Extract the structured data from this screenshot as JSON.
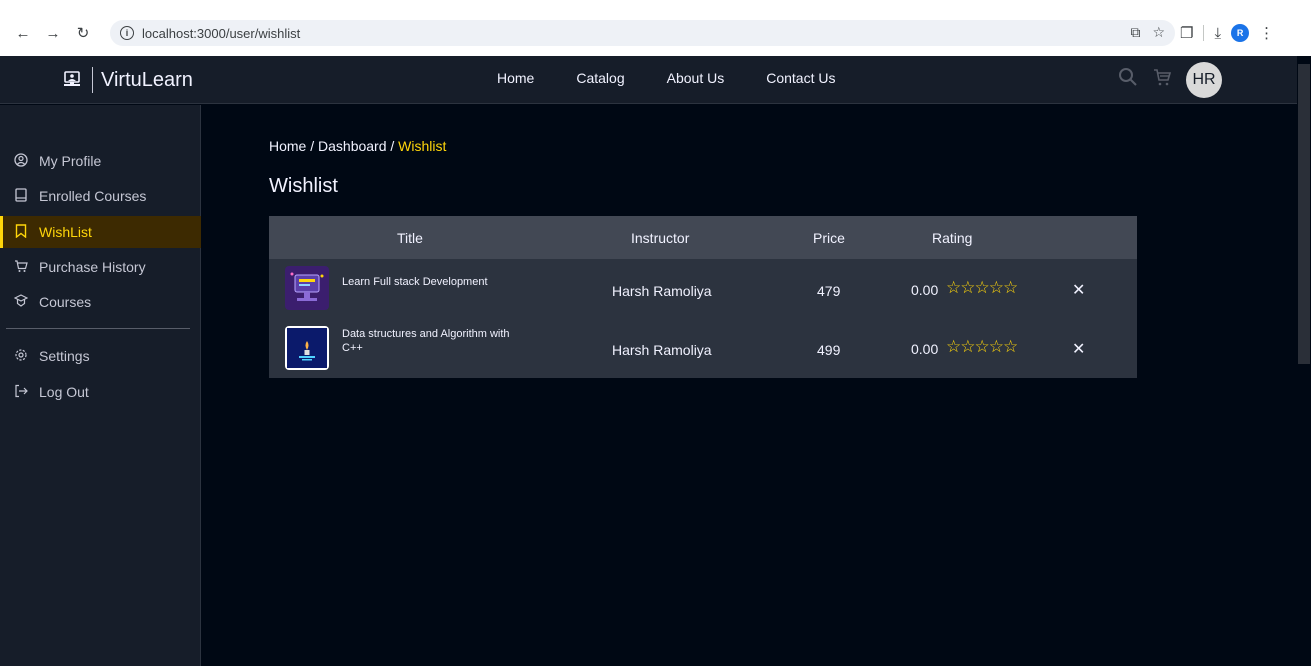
{
  "browser": {
    "url": "localhost:3000/user/wishlist",
    "profile_initial": "R"
  },
  "header": {
    "brand": "VirtuLearn",
    "nav": [
      "Home",
      "Catalog",
      "About Us",
      "Contact Us"
    ],
    "avatar_initials": "HR"
  },
  "sidebar": {
    "items": [
      {
        "label": "My Profile",
        "icon": "profile-icon"
      },
      {
        "label": "Enrolled Courses",
        "icon": "book-icon"
      },
      {
        "label": "WishList",
        "icon": "bookmark-icon",
        "active": true
      },
      {
        "label": "Purchase History",
        "icon": "cart-icon"
      },
      {
        "label": "Courses",
        "icon": "courses-icon"
      }
    ],
    "bottom_items": [
      {
        "label": "Settings",
        "icon": "gear-icon"
      },
      {
        "label": "Log Out",
        "icon": "logout-icon"
      }
    ]
  },
  "main": {
    "breadcrumb_prefix": "Home / Dashboard / ",
    "breadcrumb_current": "Wishlist",
    "title": "Wishlist",
    "columns": [
      "Title",
      "Instructor",
      "Price",
      "Rating"
    ],
    "rows": [
      {
        "title": "Learn Full stack Development",
        "instructor": "Harsh Ramoliya",
        "price": "479",
        "rating": "0.00",
        "stars": 0
      },
      {
        "title": "Data structures and Algorithm with C++",
        "instructor": "Harsh Ramoliya",
        "price": "499",
        "rating": "0.00",
        "stars": 0
      }
    ]
  },
  "colors": {
    "accent": "#ffd60a",
    "background": "#000814",
    "panel": "#161d29"
  }
}
